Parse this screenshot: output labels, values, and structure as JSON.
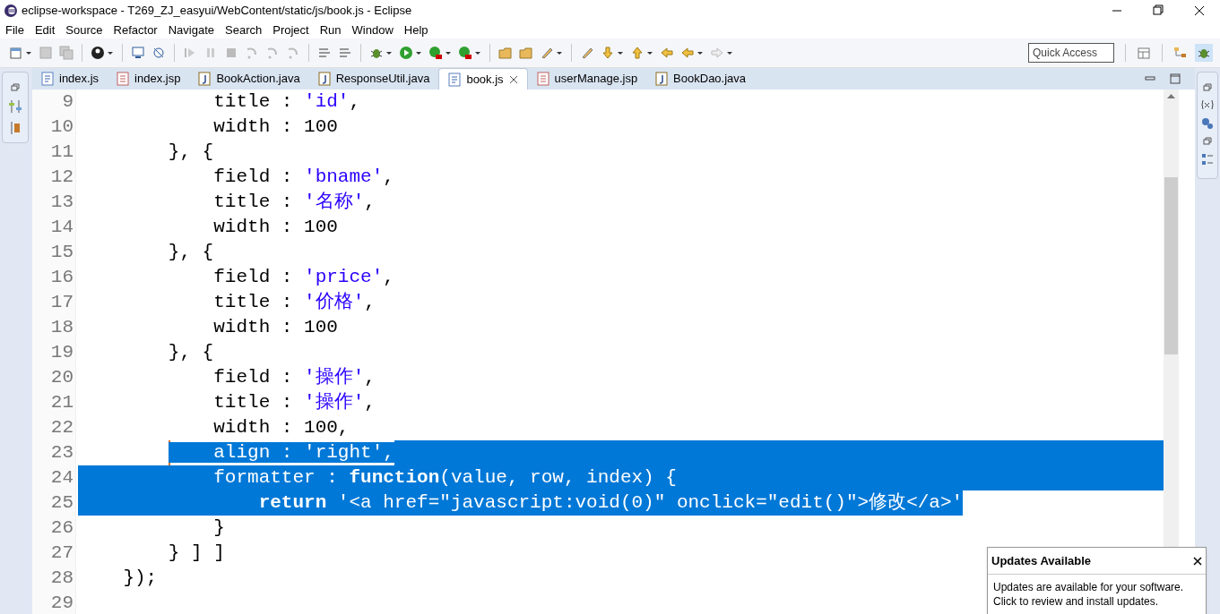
{
  "window": {
    "title": "eclipse-workspace - T269_ZJ_easyui/WebContent/static/js/book.js - Eclipse"
  },
  "menu": [
    "File",
    "Edit",
    "Source",
    "Refactor",
    "Navigate",
    "Search",
    "Project",
    "Run",
    "Window",
    "Help"
  ],
  "quick_access": {
    "placeholder": "Quick Access"
  },
  "tabs": [
    {
      "label": "index.js",
      "kind": "js",
      "selected": false
    },
    {
      "label": "index.jsp",
      "kind": "jsp",
      "selected": false
    },
    {
      "label": "BookAction.java",
      "kind": "java",
      "selected": false
    },
    {
      "label": "ResponseUtil.java",
      "kind": "java",
      "selected": false
    },
    {
      "label": "book.js",
      "kind": "js",
      "selected": true
    },
    {
      "label": "userManage.jsp",
      "kind": "jsp",
      "selected": false
    },
    {
      "label": "BookDao.java",
      "kind": "java",
      "selected": false
    }
  ],
  "editor": {
    "lines": [
      {
        "number": "9",
        "selected": false,
        "eol_selected": false,
        "has_cursor": false,
        "segments": [
          {
            "text": "            title : ",
            "kind": "plain"
          },
          {
            "text": "'id'",
            "kind": "string"
          },
          {
            "text": ",",
            "kind": "plain"
          }
        ]
      },
      {
        "number": "10",
        "selected": false,
        "eol_selected": false,
        "has_cursor": false,
        "segments": [
          {
            "text": "            width : 100",
            "kind": "plain"
          }
        ]
      },
      {
        "number": "11",
        "selected": false,
        "eol_selected": false,
        "has_cursor": false,
        "segments": [
          {
            "text": "        }, {",
            "kind": "plain"
          }
        ]
      },
      {
        "number": "12",
        "selected": false,
        "eol_selected": false,
        "has_cursor": false,
        "segments": [
          {
            "text": "            field : ",
            "kind": "plain"
          },
          {
            "text": "'bname'",
            "kind": "string"
          },
          {
            "text": ",",
            "kind": "plain"
          }
        ]
      },
      {
        "number": "13",
        "selected": false,
        "eol_selected": false,
        "has_cursor": false,
        "segments": [
          {
            "text": "            title : ",
            "kind": "plain"
          },
          {
            "text": "'名称'",
            "kind": "string"
          },
          {
            "text": ",",
            "kind": "plain"
          }
        ]
      },
      {
        "number": "14",
        "selected": false,
        "eol_selected": false,
        "has_cursor": false,
        "segments": [
          {
            "text": "            width : 100",
            "kind": "plain"
          }
        ]
      },
      {
        "number": "15",
        "selected": false,
        "eol_selected": false,
        "has_cursor": false,
        "segments": [
          {
            "text": "        }, {",
            "kind": "plain"
          }
        ]
      },
      {
        "number": "16",
        "selected": false,
        "eol_selected": false,
        "has_cursor": false,
        "segments": [
          {
            "text": "            field : ",
            "kind": "plain"
          },
          {
            "text": "'price'",
            "kind": "string"
          },
          {
            "text": ",",
            "kind": "plain"
          }
        ]
      },
      {
        "number": "17",
        "selected": false,
        "eol_selected": false,
        "has_cursor": false,
        "segments": [
          {
            "text": "            title : ",
            "kind": "plain"
          },
          {
            "text": "'价格'",
            "kind": "string"
          },
          {
            "text": ",",
            "kind": "plain"
          }
        ]
      },
      {
        "number": "18",
        "selected": false,
        "eol_selected": false,
        "has_cursor": false,
        "segments": [
          {
            "text": "            width : 100",
            "kind": "plain"
          }
        ]
      },
      {
        "number": "19",
        "selected": false,
        "eol_selected": false,
        "has_cursor": false,
        "segments": [
          {
            "text": "        }, {",
            "kind": "plain"
          }
        ]
      },
      {
        "number": "20",
        "selected": false,
        "eol_selected": false,
        "has_cursor": false,
        "segments": [
          {
            "text": "            field : ",
            "kind": "plain"
          },
          {
            "text": "'操作'",
            "kind": "string"
          },
          {
            "text": ",",
            "kind": "plain"
          }
        ]
      },
      {
        "number": "21",
        "selected": false,
        "eol_selected": false,
        "has_cursor": false,
        "segments": [
          {
            "text": "            title : ",
            "kind": "plain"
          },
          {
            "text": "'操作'",
            "kind": "string"
          },
          {
            "text": ",",
            "kind": "plain"
          }
        ]
      },
      {
        "number": "22",
        "selected": false,
        "eol_selected": false,
        "has_cursor": false,
        "segments": [
          {
            "text": "            width : 100,",
            "kind": "plain"
          }
        ]
      },
      {
        "number": "23",
        "selected": true,
        "eol_selected": true,
        "has_cursor": true,
        "segments": [
          {
            "text": "            align : 'right',",
            "kind": "plain"
          }
        ]
      },
      {
        "number": "24",
        "selected": true,
        "eol_selected": true,
        "has_cursor": false,
        "segments": [
          {
            "text": "            formatter : ",
            "kind": "plain"
          },
          {
            "text": "function",
            "kind": "keyword"
          },
          {
            "text": "(value, row, index) {",
            "kind": "plain"
          }
        ]
      },
      {
        "number": "25",
        "selected": true,
        "eol_selected": false,
        "has_cursor": false,
        "segments": [
          {
            "text": "                return",
            "kind": "keyword"
          },
          {
            "text": " '<a href=\"javascript:void(0)\" onclick=\"edit()\">修改</a>'",
            "kind": "plain"
          }
        ]
      },
      {
        "number": "26",
        "selected": false,
        "eol_selected": false,
        "has_cursor": false,
        "segments": [
          {
            "text": "            }",
            "kind": "plain"
          }
        ]
      },
      {
        "number": "27",
        "selected": false,
        "eol_selected": false,
        "has_cursor": false,
        "segments": [
          {
            "text": "        } ] ]",
            "kind": "plain"
          }
        ]
      },
      {
        "number": "28",
        "selected": false,
        "eol_selected": false,
        "has_cursor": false,
        "segments": [
          {
            "text": "    });",
            "kind": "plain"
          }
        ]
      },
      {
        "number": "29"
      }
    ]
  },
  "notification": {
    "title": "Updates Available",
    "message": "Updates are available for your software.",
    "hint": "Click to review and install updates."
  }
}
